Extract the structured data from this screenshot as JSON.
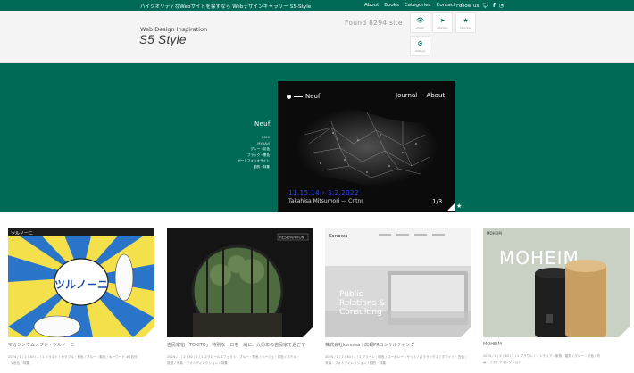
{
  "topbar": {
    "tagline": "ハイクオリティなWebサイトを探すなら Webデザインギャラリー S5-Style",
    "nav": [
      "About",
      "Books",
      "Categories",
      "Contact",
      "/"
    ],
    "follow": "Follow us"
  },
  "header": {
    "subtitle": "Web Design Inspiration",
    "logo": "S5 Style",
    "found_label": "Found",
    "found_count": "8294",
    "found_unit": "site",
    "buttons": [
      {
        "label": "Visited"
      },
      {
        "label": "Updated"
      },
      {
        "label": "Favorites"
      },
      {
        "label": "Settings"
      }
    ]
  },
  "hero": {
    "title": "Neuf",
    "meta": [
      "2020",
      "MYNAVI",
      "グレー・灰色",
      "ブラック・黒色",
      "ポートフォリオサイト",
      "動的・特集"
    ],
    "frame_logo": "Neuf",
    "frame_nav": [
      "Journal",
      "·",
      "About"
    ],
    "date": "11.15.14 › 3.2.2022",
    "caption": "Takahisa Mitsumori — Cntnr",
    "pager": "1/3"
  },
  "cards": [
    {
      "title": "マガジンウムメブレ・ツルノーニ",
      "meta_line1": "2024 / 1 / 2 / 30 / 2 / 1 イラスト / カラフル・有色 / ブルー・紫色 / キーワード #1自分",
      "meta_line2": "· リ出伝・特集"
    },
    {
      "title": "古民家宿「TOKITO」 特別な一日を一緒に、九〇年の古民家で過ごす",
      "meta_line1": "2024 / 1 / 2 / 30 / 2 / 1 スクロールエフェクト / ブルー・青色 / ベージュ・茶色 / ホテル・",
      "meta_line2": "旅館 / 写真・フォトディレクション / 特集"
    },
    {
      "title": "株式会社kenowa｜広報PRコンサルティング",
      "meta_line1": "2024 / 1 / 2 / 30 / 2 / 1 グリーン・緑色 / コーポレートサイト / パララックス / ホワイト・白色 /",
      "meta_line2": "写真・フォトディレクション / 動的・特集"
    },
    {
      "title": "MOHEIM",
      "meta_line1": "2024 / 1 / 2 / 30 / 2 / 1 ブラウン / インテリア・家具・雑貨 / グレー・灰色 / 写",
      "meta_line2": "真・フォトディレクション"
    }
  ],
  "card_texts": {
    "manga_logo": "ツルノーニ",
    "manga_top": "ツルノーニ",
    "tokito_menu": "RESERVATION",
    "kenowa_brand": "Kenowa",
    "kenowa_headline": [
      "Public",
      "Relations &",
      "Consulting"
    ],
    "moheim_brand": "MOHEIM",
    "moheim_big": "MOHEIM"
  },
  "colors": {
    "brand": "#006a57",
    "accent_blue": "#2b44ff"
  }
}
